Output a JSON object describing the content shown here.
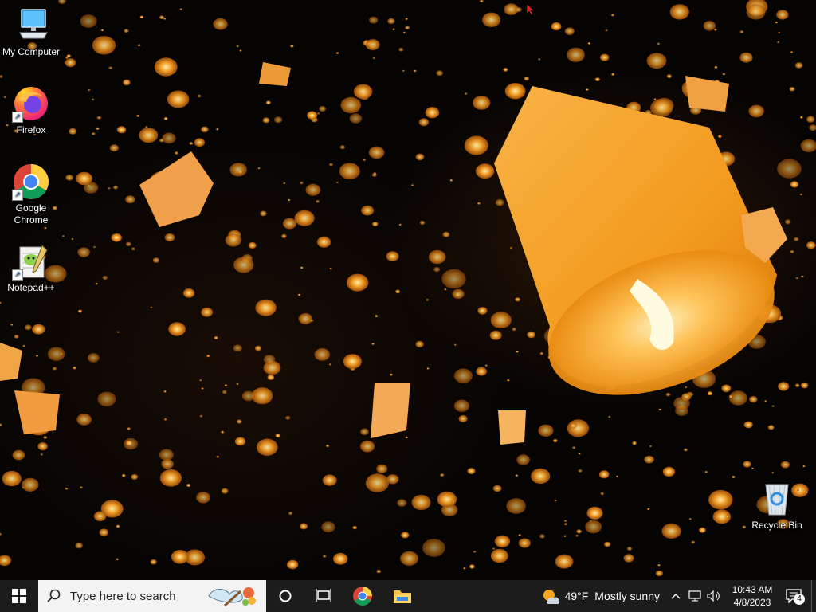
{
  "desktop": {
    "icons": [
      {
        "label": "My Computer",
        "icon": "computer-icon"
      },
      {
        "label": "Firefox",
        "icon": "firefox-icon"
      },
      {
        "label": "Google Chrome",
        "icon": "chrome-icon"
      },
      {
        "label": "Notepad++",
        "icon": "notepadpp-icon"
      },
      {
        "label": "Recycle Bin",
        "icon": "recycle-bin-icon"
      }
    ]
  },
  "taskbar": {
    "search_placeholder": "Type here to search",
    "pinned": [
      {
        "name": "Google Chrome",
        "icon": "chrome-icon"
      },
      {
        "name": "File Explorer",
        "icon": "folder-icon"
      }
    ],
    "weather": {
      "temperature": "49°F",
      "condition": "Mostly sunny"
    },
    "clock": {
      "time": "10:43 AM",
      "date": "4/8/2023"
    },
    "notifications_count": "4"
  },
  "colors": {
    "taskbar_bg": "#1c1c1c",
    "search_bg": "#f3f3f3",
    "lantern_glow": "#f7a42c"
  }
}
